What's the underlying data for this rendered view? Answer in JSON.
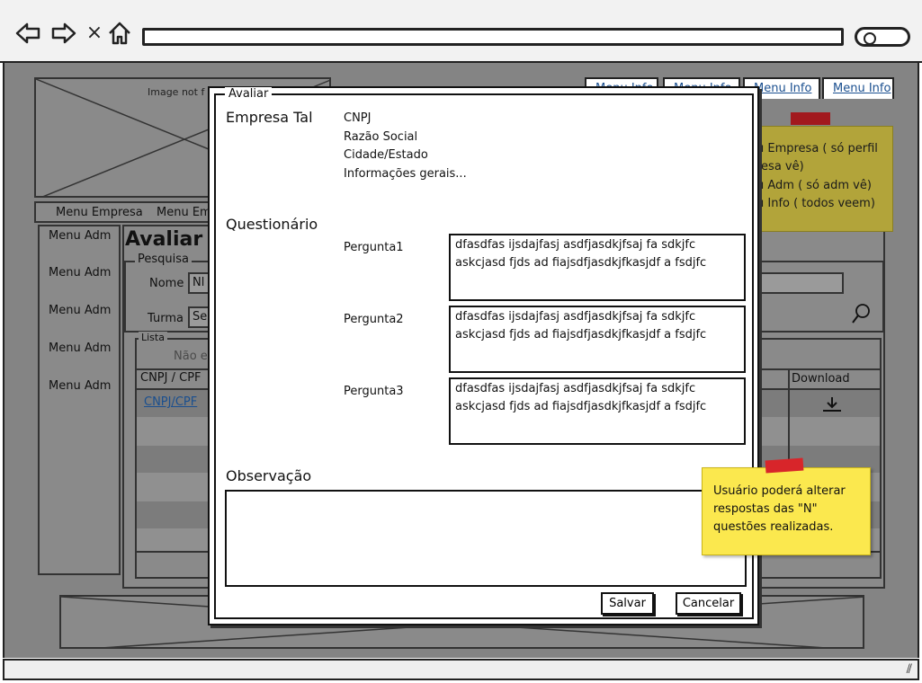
{
  "browser": {
    "back_icon": "back-arrow-icon",
    "forward_icon": "forward-arrow-icon",
    "stop_icon": "close-icon",
    "home_icon": "home-icon",
    "stop_glyph": "×"
  },
  "background_page": {
    "image_placeholder": "Image not f",
    "top_tabs": [
      "Menu Info",
      "Menu Info",
      "Menu Info",
      "Menu Info"
    ],
    "navbar": [
      "Menu Empresa",
      "Menu Emp"
    ],
    "sidebar": [
      "Menu Adm",
      "Menu Adm",
      "Menu Adm",
      "Menu Adm",
      "Menu Adm"
    ],
    "title": "Avaliar",
    "pesquisa": {
      "legend": "Pesquisa",
      "nome_label": "Nome",
      "nome_value": "Nl",
      "turma_label": "Turma",
      "turma_value": "Se"
    },
    "lista": {
      "legend": "Lista",
      "empty_text": "Não e",
      "col_cnpj": "CNPJ / CPF",
      "col_download": "Download",
      "row_link": "CNPJ/CPF"
    },
    "sticky_note": [
      "u Empresa ( só perfil",
      "resa vê)",
      "u Adm ( só adm vê)",
      "u Info ( todos veem)"
    ]
  },
  "modal": {
    "legend": "Avaliar",
    "company": {
      "name": "Empresa Tal",
      "details": [
        "CNPJ",
        "Razão Social",
        "Cidade/Estado",
        "Informações gerais..."
      ]
    },
    "questionario_title": "Questionário",
    "questions": [
      {
        "label": "Pergunta1",
        "line1": "dfasdfas ijsdajfasj asdfjasdkjfsaj fa sdkjfc",
        "line2": "askcjasd fjds ad fiajsdfjasdkjfkasjdf a fsdjfc"
      },
      {
        "label": "Pergunta2",
        "line1": "dfasdfas ijsdajfasj asdfjasdkjfsaj fa sdkjfc",
        "line2": "askcjasd fjds ad fiajsdfjasdkjfkasjdf a fsdjfc"
      },
      {
        "label": "Pergunta3",
        "line1": "dfasdfas ijsdajfasj asdfjasdkjfsaj fa sdkjfc",
        "line2": "askcjasd fjds ad fiajsdfjasdkjfkasjdf a fsdjfc"
      }
    ],
    "observacao_title": "Observação",
    "save_label": "Salvar",
    "cancel_label": "Cancelar"
  },
  "annotation_note": {
    "line1": "Usuário poderá alterar",
    "line2": "respostas das \"N\"",
    "line3": "questões realizadas."
  }
}
